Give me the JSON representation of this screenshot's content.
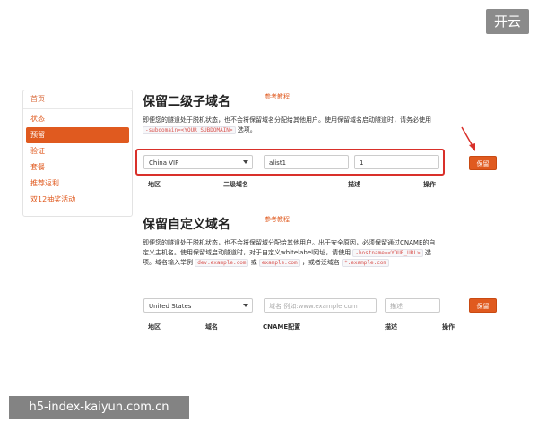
{
  "corner_button": "开云",
  "sidebar": {
    "items": [
      {
        "label": "首页"
      },
      {
        "label": "状态"
      },
      {
        "label": "预留",
        "active": true
      },
      {
        "label": "验证"
      },
      {
        "label": "套餐"
      },
      {
        "label": "推荐返利"
      },
      {
        "label": "双12抽奖活动"
      }
    ]
  },
  "subdomain_section": {
    "title": "保留二级子域名",
    "tutorial": "参考教程",
    "desc_1": "即便您的隧道处于脱机状态，也不会将保留域名分配给其他用户。使用保留域名启动隧道时，请务必使用",
    "code_1": "-subdomain=<YOUR_SUBDOMAIN>",
    "desc_2": "选项。",
    "region_value": "China VIP",
    "subdomain_value": "alist1",
    "description_value": "1",
    "save_label": "保留",
    "columns": [
      "地区",
      "二级域名",
      "描述",
      "操作"
    ]
  },
  "custom_section": {
    "title": "保留自定义域名",
    "tutorial": "参考教程",
    "desc_1": "即便您的隧道处于脱机状态，也不会将保留域分配给其他用户。出于安全原因，必须保留通过CNAME的自定义主机名。使用保留域启动隧道时，对于自定义whitelabel网址，请使用",
    "code_1": "-hostname=<YOUR_URL>",
    "desc_2": "选项。域名输入举例",
    "code_2": "dev.example.com",
    "desc_3": "或",
    "code_3": "example.com",
    "desc_4": "，或者泛域名",
    "code_4": "*.example.com",
    "region_value": "United States",
    "domain_placeholder": "域名 例如:www.example.com",
    "description_placeholder": "描述",
    "save_label": "保留",
    "columns": [
      "地区",
      "域名",
      "CNAME配置",
      "描述",
      "操作"
    ]
  },
  "watermark": "h5-index-kaiyun.com.cn",
  "colors": {
    "accent": "#e05a1f",
    "highlight": "#d9302a"
  }
}
